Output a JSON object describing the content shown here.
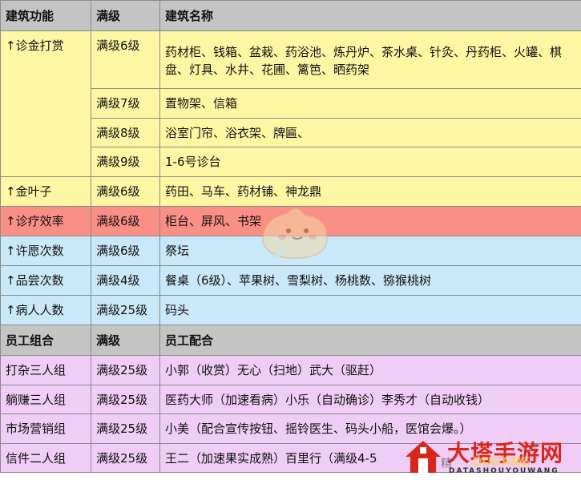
{
  "header1": {
    "col1": "建筑功能",
    "col2": "满级",
    "col3": "建筑名称"
  },
  "groups": {
    "diagnose_gold": {
      "label": "↑诊金打赏",
      "rows": [
        {
          "level": "满级6级",
          "buildings": "药材柜、钱箱、盆栽、药浴池、炼丹炉、茶水桌、针灸、丹药柜、火罐、棋盘、灯具、水井、花圃、篱笆、晒药架"
        },
        {
          "level": "满级7级",
          "buildings": "置物架、信箱"
        },
        {
          "level": "满级8级",
          "buildings": "浴室门帘、浴衣架、牌匾、"
        },
        {
          "level": "满级9级",
          "buildings": "1-6号诊台"
        }
      ]
    },
    "gold_leaf": {
      "label": "↑金叶子",
      "level": "满级6级",
      "buildings": "药田、马车、药材铺、神龙鼎"
    },
    "efficiency": {
      "label": "↑诊疗效率",
      "level": "满级6级",
      "buildings": "柜台、屏风、书架"
    },
    "wish": {
      "label": "↑许愿次数",
      "level": "满级6级",
      "buildings": "祭坛"
    },
    "taste": {
      "label": "↑品尝次数",
      "level": "满级4级",
      "buildings": "餐桌（6级）、苹果树、雪梨树、杨桃数、猕猴桃树"
    },
    "patients": {
      "label": "↑病人人数",
      "level": "满级25级",
      "buildings": "码头"
    }
  },
  "header2": {
    "col1": "员工组合",
    "col2": "满级",
    "col3": "员工配合"
  },
  "staff": [
    {
      "name": "打杂三人组",
      "level": "满级25级",
      "combo": "小郭（收赏）无心（扫地）武大（驱赶）"
    },
    {
      "name": "躺赚三人组",
      "level": "满级25级",
      "combo": "医药大师（加速看病）小乐（自动确诊）李秀才（自动收钱）"
    },
    {
      "name": "市场营销组",
      "level": "满级25级",
      "combo": "小美（配合宣传按钮、摇铃医生、码头小船，医馆会爆。）"
    },
    {
      "name": "信件二人组",
      "level": "满级25级",
      "combo": "王二（加速果实成熟）百里行（满级4-5"
    }
  ],
  "watermark": {
    "title": "大塔手游网",
    "subtitle": "DATASHOUYOUWANG",
    "overlay": "DUGAME",
    "partial": "精"
  },
  "colors": {
    "header": "#c4c4c4",
    "yellow": "#fdf7a4",
    "red": "#fa8f86",
    "blue": "#c9e8fa",
    "purple": "#efcdf7",
    "watermark_red": "#d8261c"
  },
  "icons": {
    "mascot": "blob-mascot-icon",
    "logo": "house-logo-icon"
  }
}
